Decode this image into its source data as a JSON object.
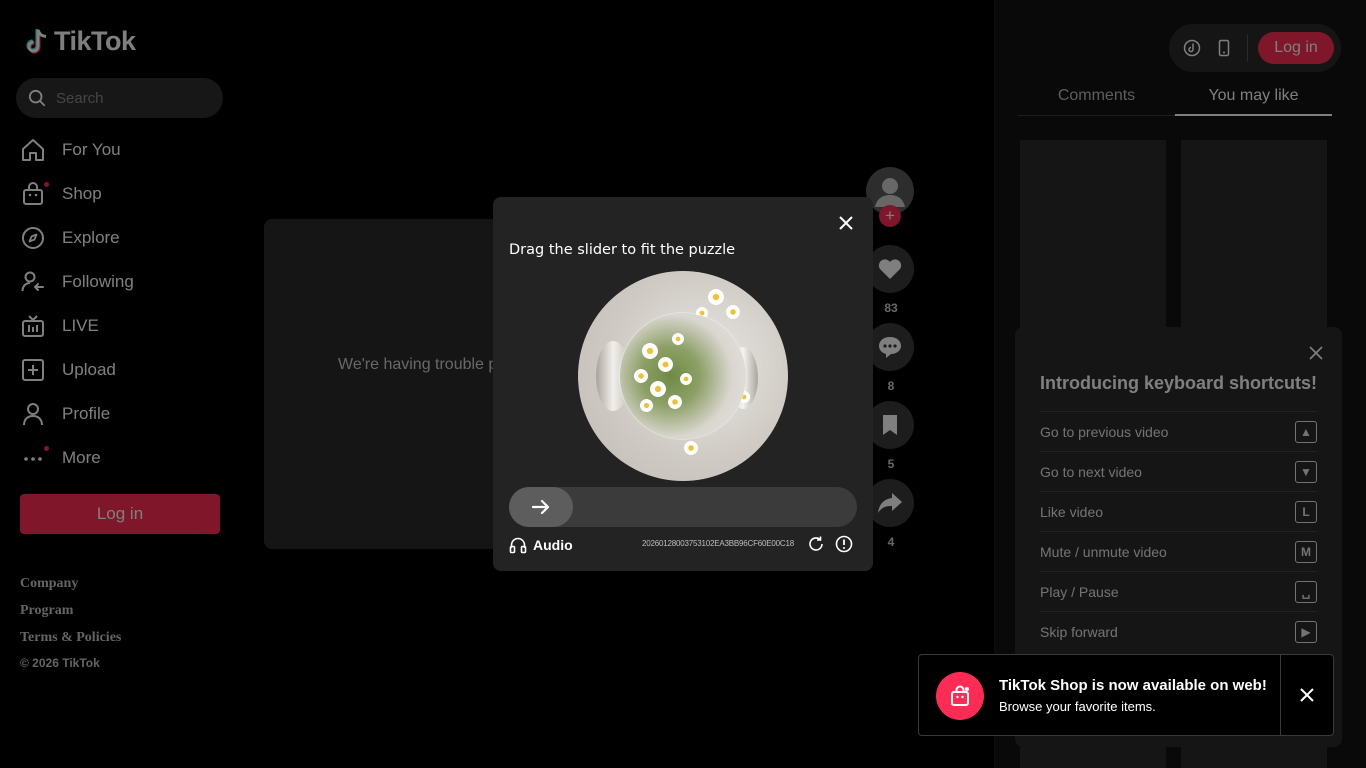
{
  "brand": {
    "logo_text": "TikTok",
    "accent": "#fe2c55"
  },
  "search": {
    "placeholder": "Search"
  },
  "sidebar": {
    "nav": [
      {
        "label": "For You",
        "icon": "home-icon"
      },
      {
        "label": "Shop",
        "icon": "shop-bag-icon"
      },
      {
        "label": "Explore",
        "icon": "compass-icon"
      },
      {
        "label": "Following",
        "icon": "following-icon"
      },
      {
        "label": "LIVE",
        "icon": "live-tv-icon"
      },
      {
        "label": "Upload",
        "icon": "upload-plus-icon"
      },
      {
        "label": "Profile",
        "icon": "profile-icon"
      },
      {
        "label": "More",
        "icon": "more-dots-icon"
      }
    ],
    "login_label": "Log in",
    "footer_links": [
      "Company",
      "Program",
      "Terms & Policies"
    ],
    "copyright": "© 2026 TikTok"
  },
  "video": {
    "error_text": "We're having trouble p"
  },
  "actions": {
    "follow_symbol": "+",
    "likes": "83",
    "comments": "8",
    "saves": "5",
    "shares": "4"
  },
  "header": {
    "login_label": "Log in"
  },
  "right_tabs": {
    "comments": "Comments",
    "you_may_like": "You may like"
  },
  "shortcuts": {
    "title": "Introducing keyboard shortcuts!",
    "items": [
      {
        "label": "Go to previous video",
        "key": "▲"
      },
      {
        "label": "Go to next video",
        "key": "▼"
      },
      {
        "label": "Like video",
        "key": "L"
      },
      {
        "label": "Mute / unmute video",
        "key": "M"
      },
      {
        "label": "Play / Pause",
        "key": "␣"
      },
      {
        "label": "Skip forward",
        "key": "▶"
      }
    ]
  },
  "captcha": {
    "title": "Drag the slider to fit the puzzle",
    "audio_label": "Audio",
    "id": "20260128003753102EA3BB96CF60E00C18",
    "slider_position": 0
  },
  "toast": {
    "title": "TikTok Shop is now available on web!",
    "subtitle": "Browse your favorite items."
  }
}
